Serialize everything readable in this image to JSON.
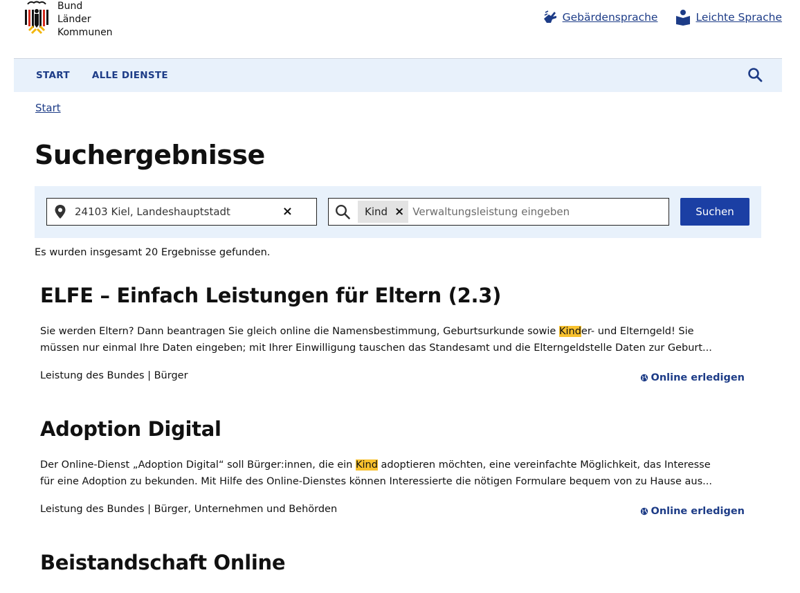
{
  "logo": {
    "lines": [
      "Bund",
      "Länder",
      "Kommunen"
    ]
  },
  "toplinks": {
    "sign_language": "Gebärdensprache",
    "easy_language": "Leichte Sprache"
  },
  "nav": {
    "items": [
      "START",
      "ALLE DIENSTE"
    ],
    "search_icon": "search-icon"
  },
  "breadcrumb": {
    "start": "Start"
  },
  "page": {
    "title": "Suchergebnisse"
  },
  "search": {
    "location_value": "24103 Kiel, Landeshauptstadt",
    "location_clear": "×",
    "chip_label": "Kind",
    "chip_remove": "×",
    "service_placeholder": "Verwaltungsleistung eingeben",
    "button_label": "Suchen"
  },
  "results_summary": "Es wurden insgesamt 20 Ergebnisse gefunden.",
  "results": [
    {
      "title": "ELFE – Einfach Leistungen für Eltern (2.3)",
      "desc_before": "Sie werden Eltern? Dann beantragen Sie gleich online die Namensbestimmung, Geburtsurkunde sowie ",
      "desc_highlight": "Kind",
      "desc_after": "er- und Elterngeld! Sie müssen nur einmal Ihre Daten eingeben; mit Ihrer Einwilligung tauschen das Standesamt und die Elterngeldstelle Daten zur Geburt...",
      "meta": "Leistung des Bundes | Bürger",
      "action": "Online erledigen"
    },
    {
      "title": "Adoption Digital",
      "desc_before": "Der Online-Dienst „Adoption Digital“ soll Bürger:innen, die ein ",
      "desc_highlight": "Kind",
      "desc_after": " adoptieren möchten, eine vereinfachte Möglichkeit, das Interesse für eine Adoption zu bekunden. Mit Hilfe des Online-Dienstes können Interessierte die nötigen Formulare bequem von zu Hause aus...",
      "meta": "Leistung des Bundes | Bürger, Unternehmen und Behörden",
      "action": "Online erledigen"
    },
    {
      "title": "Beistandschaft Online"
    }
  ],
  "colors": {
    "accent": "#1d3c87",
    "button": "#1b3fa4",
    "panel": "#e8f1fb",
    "highlight": "#f8c12e"
  }
}
